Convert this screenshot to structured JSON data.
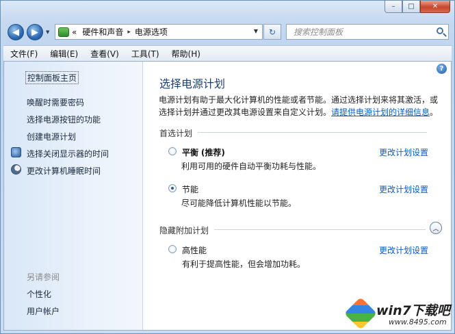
{
  "window": {
    "minimize_glyph": "–",
    "maximize_glyph": "□",
    "close_glyph": "✕"
  },
  "nav": {
    "back_glyph": "◀",
    "forward_glyph": "▶",
    "address": {
      "overflow": "«",
      "crumbs": [
        "硬件和声音",
        "电源选项"
      ],
      "separator": "▸"
    },
    "refresh_glyph": "↻",
    "search_placeholder": "搜索控制面板"
  },
  "menu": [
    "文件(F)",
    "编辑(E)",
    "查看(V)",
    "工具(T)",
    "帮助(H)"
  ],
  "sidebar": {
    "home": "控制面板主页",
    "links": [
      "唤醒时需要密码",
      "选择电源按钮的功能",
      "创建电源计划",
      "选择关闭显示器的时间",
      "更改计算机睡眠时间"
    ],
    "see_also_title": "另请参阅",
    "see_also": [
      "个性化",
      "用户帐户"
    ]
  },
  "main": {
    "help_glyph": "?",
    "title": "选择电源计划",
    "description": "电源计划有助于最大化计算机的性能或者节能。通过选择计划来将其激活，或选择计划并通过更改其电源设置来自定义计划。",
    "description_link": "请提供电源计划的详细信息",
    "description_end": "。",
    "preferred_header": "首选计划",
    "hidden_header": "隐藏附加计划",
    "collapse_glyph": "︿",
    "plans": [
      {
        "name": "平衡",
        "tag": "(推荐)",
        "desc": "利用可用的硬件自动平衡功耗与性能。",
        "selected": false,
        "change": "更改计划设置"
      },
      {
        "name": "节能",
        "tag": "",
        "desc": "尽可能降低计算机性能以节能。",
        "selected": true,
        "change": "更改计划设置"
      },
      {
        "name": "高性能",
        "tag": "",
        "desc": "有利于提高性能，但会增加功耗。",
        "selected": false,
        "change": "更改计划设置"
      }
    ]
  },
  "watermark": {
    "title": "win7下载吧",
    "url": "www.8495.com"
  }
}
